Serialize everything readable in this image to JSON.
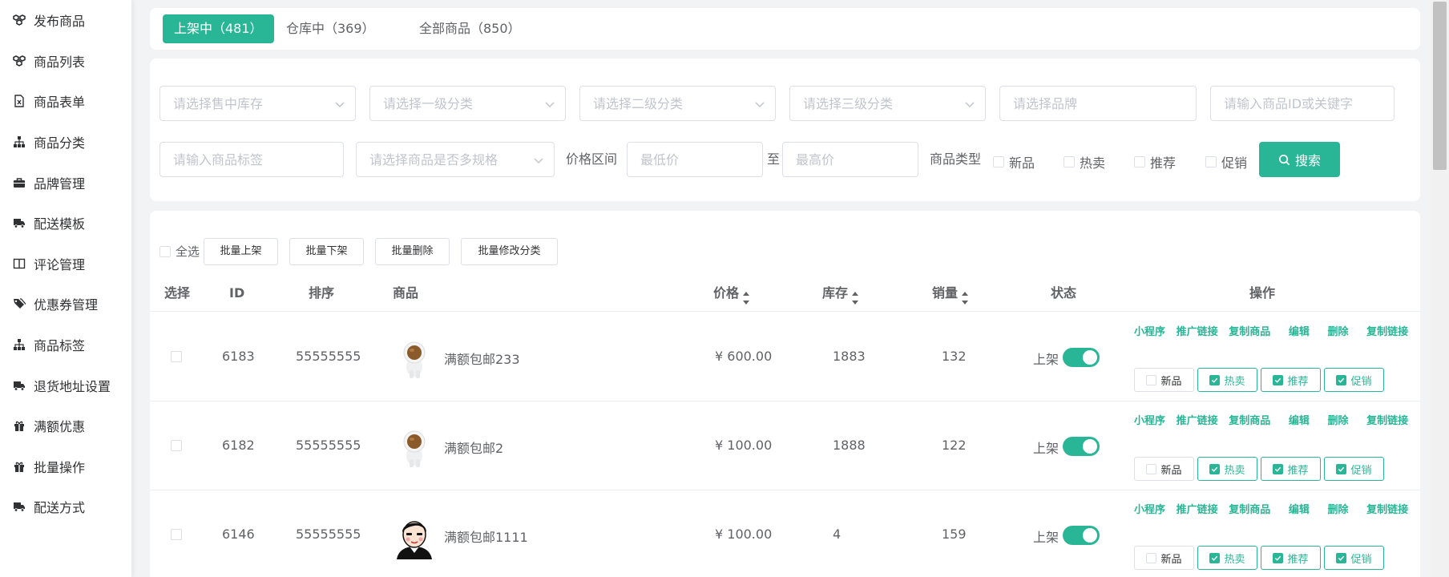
{
  "sidebar": {
    "items": [
      {
        "label": "发布商品",
        "icon": "cubes-icon"
      },
      {
        "label": "商品列表",
        "icon": "cubes-icon"
      },
      {
        "label": "商品表单",
        "icon": "file-excel-icon"
      },
      {
        "label": "商品分类",
        "icon": "sitemap-icon"
      },
      {
        "label": "品牌管理",
        "icon": "briefcase-icon"
      },
      {
        "label": "配送模板",
        "icon": "truck-icon"
      },
      {
        "label": "评论管理",
        "icon": "columns-icon"
      },
      {
        "label": "优惠券管理",
        "icon": "tags-icon"
      },
      {
        "label": "商品标签",
        "icon": "sitemap-icon"
      },
      {
        "label": "退货地址设置",
        "icon": "truck-icon"
      },
      {
        "label": "满额优惠",
        "icon": "gift-icon"
      },
      {
        "label": "批量操作",
        "icon": "gift-icon"
      },
      {
        "label": "配送方式",
        "icon": "truck-icon"
      }
    ]
  },
  "tabs": [
    {
      "label": "上架中（481）",
      "active": true
    },
    {
      "label": "仓库中（369）",
      "active": false
    },
    {
      "label": "全部商品（850）",
      "active": false
    }
  ],
  "filters": {
    "stock_placeholder": "请选择售中库存",
    "cat1_placeholder": "请选择一级分类",
    "cat2_placeholder": "请选择二级分类",
    "cat3_placeholder": "请选择三级分类",
    "brand_placeholder": "请选择品牌",
    "keyword_placeholder": "请输入商品ID或关键字",
    "tag_placeholder": "请输入商品标签",
    "spec_placeholder": "请选择商品是否多规格",
    "price_range_label": "价格区间",
    "min_price_placeholder": "最低价",
    "to_label": "至",
    "max_price_placeholder": "最高价",
    "type_label": "商品类型",
    "type_options": [
      "新品",
      "热卖",
      "推荐",
      "促销"
    ],
    "search_label": "搜索"
  },
  "batch": {
    "select_all": "全选",
    "buttons": [
      "批量上架",
      "批量下架",
      "批量删除",
      "批量修改分类"
    ]
  },
  "table": {
    "headers": {
      "select": "选择",
      "id": "ID",
      "sort": "排序",
      "product": "商品",
      "price": "价格",
      "stock": "库存",
      "sales": "销量",
      "status": "状态",
      "ops": "操作"
    },
    "op_links": [
      "小程序",
      "推广链接",
      "复制商品",
      "编辑",
      "删除",
      "复制链接"
    ],
    "flag_labels": [
      "新品",
      "热卖",
      "推荐",
      "促销"
    ],
    "rows": [
      {
        "id": "6183",
        "sort": "55555555",
        "name": "满额包邮233",
        "price": "¥ 600.00",
        "stock": "1883",
        "sales": "132",
        "status": "上架",
        "thumb": "astronaut",
        "flags": [
          false,
          true,
          true,
          true
        ]
      },
      {
        "id": "6182",
        "sort": "55555555",
        "name": "满额包邮2",
        "price": "¥ 100.00",
        "stock": "1888",
        "sales": "122",
        "status": "上架",
        "thumb": "astronaut",
        "flags": [
          false,
          true,
          true,
          true
        ]
      },
      {
        "id": "6146",
        "sort": "55555555",
        "name": "满额包邮1111",
        "price": "¥ 100.00",
        "stock": "4",
        "sales": "159",
        "status": "上架",
        "thumb": "cartoon-face",
        "flags": [
          false,
          true,
          true,
          true
        ]
      }
    ]
  },
  "colors": {
    "accent": "#29b697"
  }
}
